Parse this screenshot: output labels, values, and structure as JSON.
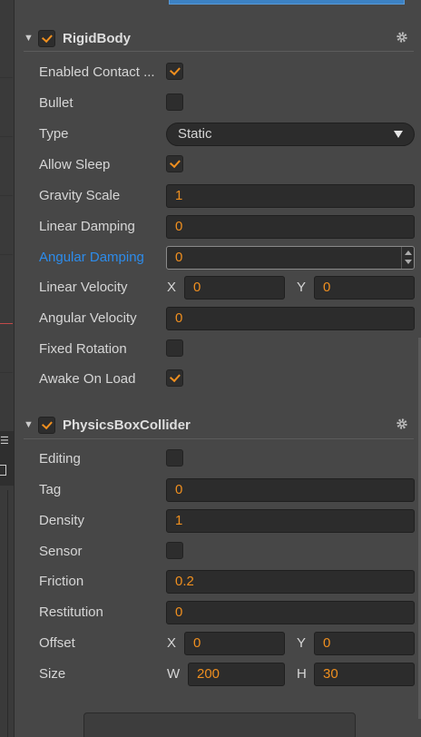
{
  "rigidbody": {
    "title": "RigidBody",
    "enabled": true,
    "rows": {
      "enabled_contact": {
        "label": "Enabled Contact ...",
        "checked": true
      },
      "bullet": {
        "label": "Bullet",
        "checked": false
      },
      "type": {
        "label": "Type",
        "value": "Static"
      },
      "allow_sleep": {
        "label": "Allow Sleep",
        "checked": true
      },
      "gravity_scale": {
        "label": "Gravity Scale",
        "value": "1"
      },
      "linear_damping": {
        "label": "Linear Damping",
        "value": "0"
      },
      "angular_damping": {
        "label": "Angular Damping",
        "value": "0"
      },
      "linear_velocity": {
        "label": "Linear Velocity",
        "x_label": "X",
        "x": "0",
        "y_label": "Y",
        "y": "0"
      },
      "angular_velocity": {
        "label": "Angular Velocity",
        "value": "0"
      },
      "fixed_rotation": {
        "label": "Fixed Rotation",
        "checked": false
      },
      "awake_on_load": {
        "label": "Awake On Load",
        "checked": true
      }
    }
  },
  "physicsbox": {
    "title": "PhysicsBoxCollider",
    "enabled": true,
    "rows": {
      "editing": {
        "label": "Editing",
        "checked": false
      },
      "tag": {
        "label": "Tag",
        "value": "0"
      },
      "density": {
        "label": "Density",
        "value": "1"
      },
      "sensor": {
        "label": "Sensor",
        "checked": false
      },
      "friction": {
        "label": "Friction",
        "value": "0.2"
      },
      "restitution": {
        "label": "Restitution",
        "value": "0"
      },
      "offset": {
        "label": "Offset",
        "x_label": "X",
        "x": "0",
        "y_label": "Y",
        "y": "0"
      },
      "size": {
        "label": "Size",
        "w_label": "W",
        "w": "200",
        "h_label": "H",
        "h": "30"
      }
    }
  },
  "colors": {
    "accent": "#ef8f1f",
    "active_label": "#2d8ceb",
    "panel_bg": "#474747",
    "field_bg": "#2c2c2c"
  },
  "icons": {
    "collapse": "triangle-down-icon",
    "settings": "gear-icon",
    "check": "checkmark-icon"
  }
}
